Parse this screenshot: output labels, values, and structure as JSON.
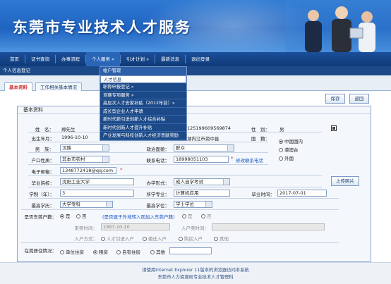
{
  "banner": {
    "title": "东莞市专业技术人才服务"
  },
  "nav": {
    "items": [
      "首页",
      "证书查询",
      "办事流程",
      "个人服务 »",
      "引才计划 »",
      "最新消息",
      "退出登录"
    ]
  },
  "breadcrumb": "个人信息登记",
  "tabs": [
    "基本资料",
    "工作相关基本情况"
  ],
  "buttons": {
    "save": "保存",
    "back": "返回",
    "upload_photo": "上传照片"
  },
  "dropdown": {
    "items": [
      "帐户管理",
      "人才信息",
      "职称申报登记 »",
      "竞赛专项服务 »",
      "高层次人才安家补贴（2012年前）»",
      "成长型企业人才申请",
      "新时代新引进创新人才综合补贴",
      "新时代创新人才提升补贴",
      "产业发展与科技创新人才经济贡献奖励"
    ]
  },
  "section_title": "基本资料",
  "form": {
    "name_label": "姓　名：",
    "name_value": "郑先生",
    "id_value": "125199609569874",
    "gender_label": "性　别：",
    "gender_value": "男",
    "birth_label": "出生年月：",
    "birth_value": "1996-10-10",
    "origin_value": "湖内江市资中县",
    "nationality_label": "国　籍：",
    "nationality_options": [
      "中国国内",
      "港澳台",
      "外国"
    ],
    "ethnic_label": "民　族：",
    "ethnic_value": "汉族",
    "political_label": "政治面貌：",
    "political_value": "群众",
    "hukou_label": "户口性质：",
    "hukou_value": "非本市农村",
    "phone_label": "联系电话：",
    "phone_value": "18998051103",
    "phone_link": "修改联系电话",
    "email_label": "电子邮箱：",
    "email_value": "1348772418@qq.com",
    "school_label": "毕业院校：",
    "school_value": "沈阳工业大学",
    "study_form_label": "办学形式：",
    "study_form_value": "成人自学考试",
    "length_label": "学制（年）：",
    "length_value": "3",
    "major_label": "所学专业：",
    "major_value": "计算机应用",
    "grad_label": "毕业时间：",
    "grad_value": "2017-07-01",
    "edu_label": "最高学历：",
    "edu_value": "大学专科",
    "degree_label": "最高学位：",
    "degree_value": "学士学位",
    "talent_label": "是否东莞户籍：",
    "talent_yes": "是",
    "talent_no": "否",
    "talent_hint": "(是否属于外地转入而加入东莞户籍)",
    "inner_yes": "是",
    "inner_no": "否",
    "arrive_label": "来莞时间：",
    "arrive_value": "1997-10-10",
    "enter_label": "入户莞时间：",
    "method_label": "入户方式：",
    "methods": [
      "人才引进入户",
      "婚迁入户",
      "购房入户",
      "其他"
    ],
    "residence_label": "在莞居住情况：",
    "residence_options": [
      "单位住房",
      "租房",
      "自有住房",
      "其他"
    ]
  },
  "footer": {
    "line1": "请使用Internet Explorer 11版本的浏览器访问本系统",
    "line2": "东莞市人力资源局专业技术人才管理科"
  }
}
